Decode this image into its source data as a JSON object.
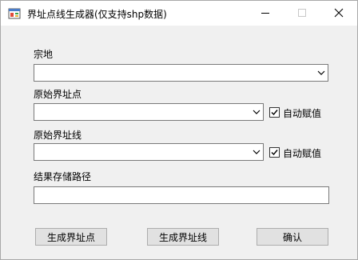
{
  "window": {
    "title": "界址点线生成器(仅支持shp数据)",
    "icon": "app-icon",
    "controls": {
      "minimize": "minimize-icon",
      "maximize": "maximize-icon",
      "close": "close-icon"
    }
  },
  "form": {
    "parcel": {
      "label": "宗地",
      "value": ""
    },
    "original_points": {
      "label": "原始界址点",
      "value": "",
      "auto_assign_label": "自动赋值",
      "auto_assign_checked": true
    },
    "original_lines": {
      "label": "原始界址线",
      "value": "",
      "auto_assign_label": "自动赋值",
      "auto_assign_checked": true
    },
    "result_path": {
      "label": "结果存储路径",
      "value": ""
    }
  },
  "buttons": {
    "gen_points": "生成界址点",
    "gen_lines": "生成界址线",
    "confirm": "确认"
  }
}
